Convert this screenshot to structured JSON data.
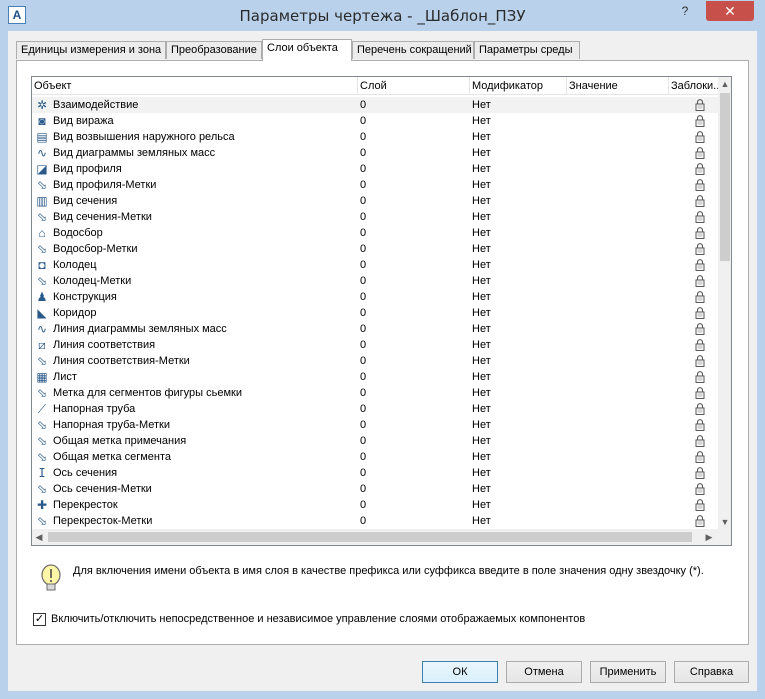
{
  "window": {
    "title": "Параметры чертежа - _Шаблон_ПЗУ",
    "help_glyph": "?",
    "close_glyph": "✕",
    "app_icon_letter": "A"
  },
  "tabs": [
    {
      "label": "Единицы измерения и зона",
      "active": false
    },
    {
      "label": "Преобразование",
      "active": false
    },
    {
      "label": "Слои объекта",
      "active": true
    },
    {
      "label": "Перечень сокращений",
      "active": false
    },
    {
      "label": "Параметры среды",
      "active": false
    }
  ],
  "grid": {
    "columns": {
      "object": "Объект",
      "layer": "Слой",
      "modifier": "Модификатор",
      "value": "Значение",
      "locked": "Заблоки..."
    },
    "rows": [
      {
        "icon": "interference-icon",
        "glyph": "✲",
        "object": "Взаимодействие",
        "layer": "0",
        "modifier": "Нет",
        "value": "",
        "selected": true
      },
      {
        "icon": "superelevation-view-icon",
        "glyph": "◙",
        "object": "Вид виража",
        "layer": "0",
        "modifier": "Нет",
        "value": ""
      },
      {
        "icon": "cant-view-icon",
        "glyph": "▤",
        "object": "Вид возвышения наружного рельса",
        "layer": "0",
        "modifier": "Нет",
        "value": ""
      },
      {
        "icon": "mass-haul-view-icon",
        "glyph": "∿",
        "object": "Вид диаграммы земляных масс",
        "layer": "0",
        "modifier": "Нет",
        "value": ""
      },
      {
        "icon": "profile-view-icon",
        "glyph": "◪",
        "object": "Вид профиля",
        "layer": "0",
        "modifier": "Нет",
        "value": ""
      },
      {
        "icon": "label-tag-icon",
        "glyph": "⬂",
        "object": "Вид профиля-Метки",
        "layer": "0",
        "modifier": "Нет",
        "value": ""
      },
      {
        "icon": "section-view-icon",
        "glyph": "▥",
        "object": "Вид сечения",
        "layer": "0",
        "modifier": "Нет",
        "value": ""
      },
      {
        "icon": "label-tag-icon",
        "glyph": "⬂",
        "object": "Вид сечения-Метки",
        "layer": "0",
        "modifier": "Нет",
        "value": ""
      },
      {
        "icon": "catchment-icon",
        "glyph": "⌂",
        "object": "Водосбор",
        "layer": "0",
        "modifier": "Нет",
        "value": ""
      },
      {
        "icon": "label-tag-icon",
        "glyph": "⬂",
        "object": "Водосбор-Метки",
        "layer": "0",
        "modifier": "Нет",
        "value": ""
      },
      {
        "icon": "structure-icon",
        "glyph": "◘",
        "object": "Колодец",
        "layer": "0",
        "modifier": "Нет",
        "value": ""
      },
      {
        "icon": "label-tag-icon",
        "glyph": "⬂",
        "object": "Колодец-Метки",
        "layer": "0",
        "modifier": "Нет",
        "value": ""
      },
      {
        "icon": "subassembly-icon",
        "glyph": "♟",
        "object": "Конструкция",
        "layer": "0",
        "modifier": "Нет",
        "value": ""
      },
      {
        "icon": "corridor-icon",
        "glyph": "◣",
        "object": "Коридор",
        "layer": "0",
        "modifier": "Нет",
        "value": ""
      },
      {
        "icon": "mass-haul-line-icon",
        "glyph": "∿",
        "object": "Линия диаграммы земляных масс",
        "layer": "0",
        "modifier": "Нет",
        "value": ""
      },
      {
        "icon": "match-line-icon",
        "glyph": "⧄",
        "object": "Линия соответствия",
        "layer": "0",
        "modifier": "Нет",
        "value": ""
      },
      {
        "icon": "label-tag-icon",
        "glyph": "⬂",
        "object": "Линия соответствия-Метки",
        "layer": "0",
        "modifier": "Нет",
        "value": ""
      },
      {
        "icon": "sheet-icon",
        "glyph": "▦",
        "object": "Лист",
        "layer": "0",
        "modifier": "Нет",
        "value": ""
      },
      {
        "icon": "label-tag-icon",
        "glyph": "⬂",
        "object": "Метка для сегментов фигуры сьемки",
        "layer": "0",
        "modifier": "Нет",
        "value": ""
      },
      {
        "icon": "pressure-pipe-icon",
        "glyph": "⟋",
        "object": "Напорная труба",
        "layer": "0",
        "modifier": "Нет",
        "value": ""
      },
      {
        "icon": "label-tag-icon",
        "glyph": "⬂",
        "object": "Напорная труба-Метки",
        "layer": "0",
        "modifier": "Нет",
        "value": ""
      },
      {
        "icon": "label-tag-icon",
        "glyph": "⬂",
        "object": "Общая метка примечания",
        "layer": "0",
        "modifier": "Нет",
        "value": ""
      },
      {
        "icon": "label-tag-icon",
        "glyph": "⬂",
        "object": "Общая метка сегмента",
        "layer": "0",
        "modifier": "Нет",
        "value": ""
      },
      {
        "icon": "sample-line-icon",
        "glyph": "ⵊ",
        "object": "Ось сечения",
        "layer": "0",
        "modifier": "Нет",
        "value": ""
      },
      {
        "icon": "label-tag-icon",
        "glyph": "⬂",
        "object": "Ось сечения-Метки",
        "layer": "0",
        "modifier": "Нет",
        "value": ""
      },
      {
        "icon": "intersection-icon",
        "glyph": "✚",
        "object": "Перекресток",
        "layer": "0",
        "modifier": "Нет",
        "value": ""
      },
      {
        "icon": "label-tag-icon",
        "glyph": "⬂",
        "object": "Перекресток-Метки",
        "layer": "0",
        "modifier": "Нет",
        "value": ""
      }
    ]
  },
  "hint": {
    "text": "Для включения имени объекта в имя слоя в качестве префикса или суффикса введите в поле значения одну звездочку (*)."
  },
  "checkbox": {
    "checked": true,
    "glyph": "✓",
    "label": "Включить/отключить непосредственное и независимое управление слоями отображаемых компонентов"
  },
  "buttons": {
    "ok": "ОК",
    "cancel": "Отмена",
    "apply": "Применить",
    "help": "Справка"
  },
  "colors": {
    "frame": "#b9d1ea",
    "close_button": "#c7504a",
    "client": "#f0f0f0",
    "selected_row": "#f2f2f2"
  }
}
